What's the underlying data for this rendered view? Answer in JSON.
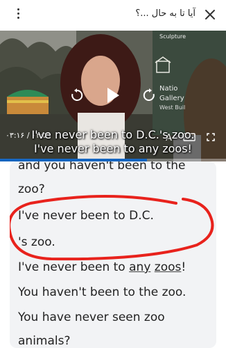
{
  "header": {
    "title": "آیا تا به حال ...؟",
    "close_icon": "close-icon",
    "menu_icon": "kebab-menu-icon"
  },
  "video": {
    "time_display": "۰۳:۱۶ / ۰۴:۵۹",
    "sign_text": {
      "top": "Sculpture",
      "line1": "Natio",
      "line2": "Gallery",
      "line3": "West Buil"
    },
    "captions": {
      "line1": "I've never been to D.C.'s zoo.",
      "line2": "I've never been to any zoos!"
    },
    "progress_fraction": 0.65,
    "controls": [
      "rewind-icon",
      "play-icon",
      "forward-icon",
      "subtitles-icon",
      "cast-icon",
      "fullscreen-icon"
    ],
    "colors": {
      "progress": "#1565c0"
    }
  },
  "transcript": {
    "lines": {
      "l0": "and you haven't been to the",
      "l1": "zoo?",
      "l2": "I've never been to D.C.",
      "l3": "'s zoo.",
      "l4a": "I've never been to ",
      "l4b": "any",
      "l4c": " ",
      "l4d": "zoos",
      "l4e": "!",
      "l5": "You haven't been to the zoo.",
      "l6": "You have never seen zoo",
      "l7": "animals?"
    },
    "highlight_color": "#e8221c"
  }
}
